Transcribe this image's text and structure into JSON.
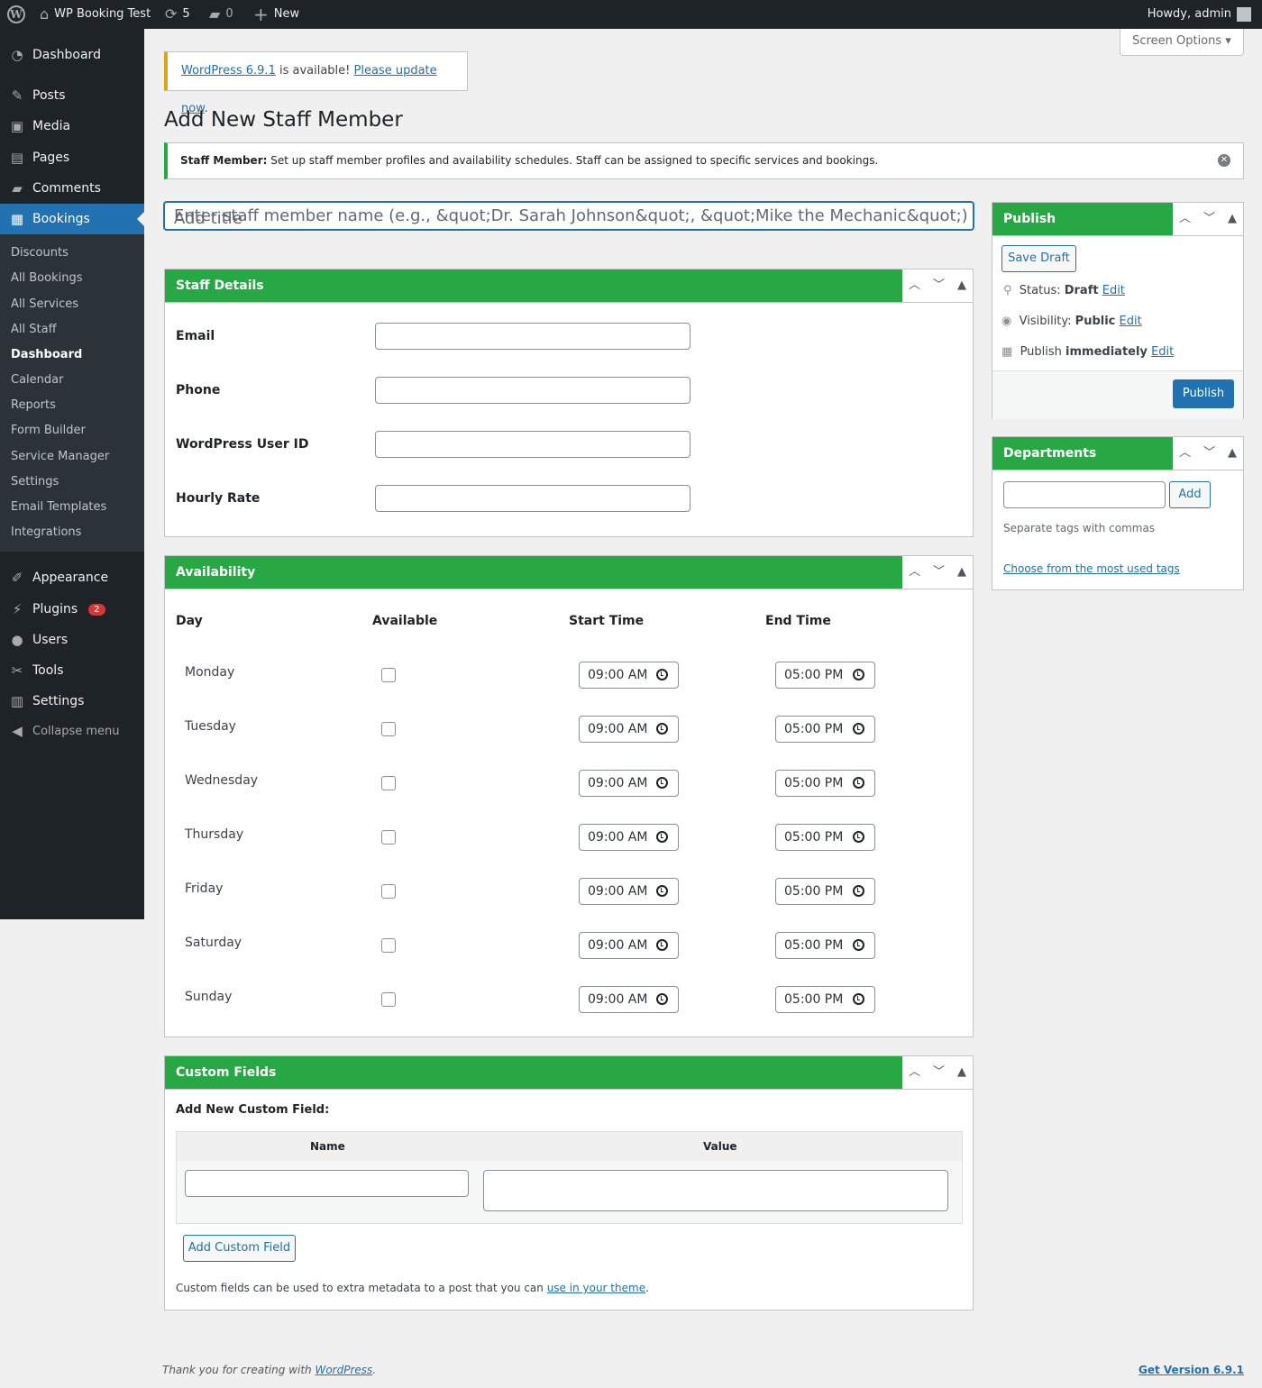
{
  "adminbar": {
    "site": "WP Booking Test",
    "updates": "5",
    "comments": "0",
    "new": "New",
    "howdy": "Howdy, admin"
  },
  "menu": {
    "dashboard": "Dashboard",
    "posts": "Posts",
    "media": "Media",
    "pages": "Pages",
    "comments": "Comments",
    "bookings": "Bookings",
    "sub": [
      "Discounts",
      "All Bookings",
      "All Services",
      "All Staff",
      "Dashboard",
      "Calendar",
      "Reports",
      "Form Builder",
      "Service Manager",
      "Settings",
      "Email Templates",
      "Integrations"
    ],
    "appearance": "Appearance",
    "plugins": "Plugins",
    "plugins_badge": "2",
    "users": "Users",
    "tools": "Tools",
    "settings": "Settings",
    "collapse": "Collapse menu"
  },
  "screen_options": "Screen Options",
  "notice": {
    "link1": "WordPress 6.9.1",
    "text": " is available! ",
    "link2": "Please update now",
    "end": "."
  },
  "page_title": "Add New Staff Member",
  "info": {
    "bold": "Staff Member:",
    "text": " Set up staff member profiles and availability schedules. Staff can be assigned to specific services and bookings."
  },
  "title_input": {
    "label": "Add title",
    "placeholder": "Enter staff member name (e.g., &quot;Dr. Sarah Johnson&quot;, &quot;Mike the Mechanic&quot;)"
  },
  "staff_details": {
    "title": "Staff Details",
    "fields": [
      "Email",
      "Phone",
      "WordPress User ID",
      "Hourly Rate"
    ]
  },
  "availability": {
    "title": "Availability",
    "headers": [
      "Day",
      "Available",
      "Start Time",
      "End Time"
    ],
    "rows": [
      {
        "day": "Monday",
        "start": "09:00 AM",
        "end": "05:00 PM"
      },
      {
        "day": "Tuesday",
        "start": "09:00 AM",
        "end": "05:00 PM"
      },
      {
        "day": "Wednesday",
        "start": "09:00 AM",
        "end": "05:00 PM"
      },
      {
        "day": "Thursday",
        "start": "09:00 AM",
        "end": "05:00 PM"
      },
      {
        "day": "Friday",
        "start": "09:00 AM",
        "end": "05:00 PM"
      },
      {
        "day": "Saturday",
        "start": "09:00 AM",
        "end": "05:00 PM"
      },
      {
        "day": "Sunday",
        "start": "09:00 AM",
        "end": "05:00 PM"
      }
    ]
  },
  "custom_fields": {
    "title": "Custom Fields",
    "add_new": "Add New Custom Field:",
    "name_h": "Name",
    "value_h": "Value",
    "add_btn": "Add Custom Field",
    "help": "Custom fields can be used to extra metadata to a post that you can ",
    "help_link": "use in your theme",
    "help_end": "."
  },
  "publish": {
    "title": "Publish",
    "save_draft": "Save Draft",
    "status_label": "Status: ",
    "status": "Draft",
    "visibility_label": "Visibility: ",
    "visibility": "Public",
    "publish_label": "Publish ",
    "publish_when": "immediately",
    "edit": "Edit",
    "publish_btn": "Publish"
  },
  "departments": {
    "title": "Departments",
    "add": "Add",
    "help": "Separate tags with commas",
    "choose": "Choose from the most used tags"
  },
  "footer": {
    "thanks": "Thank you for creating with ",
    "wp": "WordPress",
    "end": ".",
    "version": "Get Version 6.9.1"
  },
  "colors": {
    "accent": "#28a745",
    "link": "#2271b1",
    "sidebar": "#1d2327"
  }
}
